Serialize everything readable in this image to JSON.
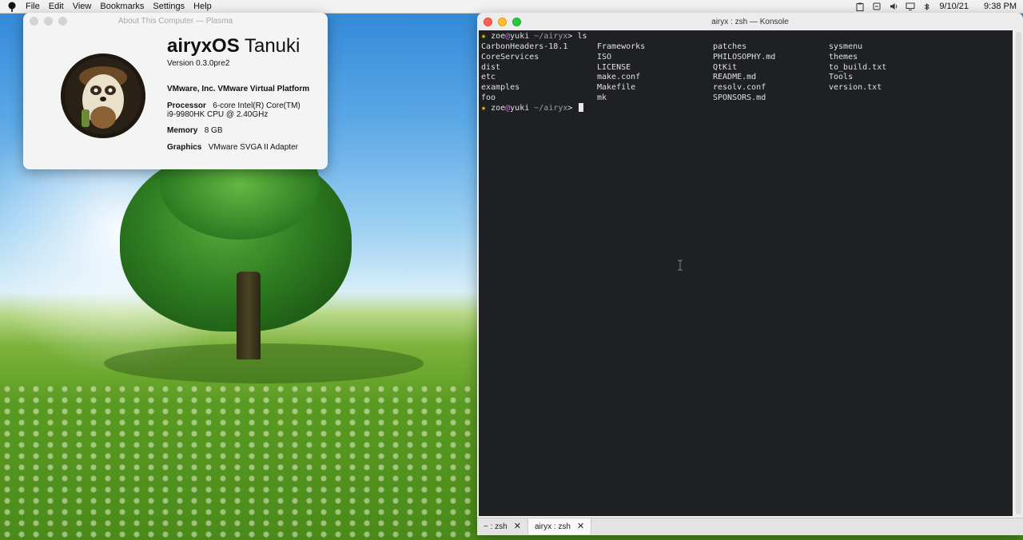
{
  "menubar": {
    "logo_icon": "tree-logo-icon",
    "items": [
      "File",
      "Edit",
      "View",
      "Bookmarks",
      "Settings",
      "Help"
    ],
    "date": "9/10/21",
    "time": "9:38 PM"
  },
  "about": {
    "title": "About This Computer — Plasma",
    "os_name_bold": "airyxOS",
    "os_name_light": " Tanuki",
    "version": "Version 0.3.0pre2",
    "platform": "VMware, Inc. VMware Virtual Platform",
    "processor_label": "Processor",
    "processor_value_1": "6-core Intel(R) Core(TM)",
    "processor_value_2": "i9-9980HK CPU @ 2.40GHz",
    "memory_label": "Memory",
    "memory_value": "8 GB",
    "graphics_label": "Graphics",
    "graphics_value": "VMware SVGA II Adapter"
  },
  "konsole": {
    "title": "airyx : zsh — Konsole",
    "prompt": {
      "star": "★",
      "user": "zoe",
      "at": "@",
      "host": "yuki",
      "path": " ~/airyx",
      "symbol": ">",
      "command": " ls"
    },
    "listing": [
      [
        "CarbonHeaders-18.1",
        "Frameworks",
        "patches",
        "sysmenu"
      ],
      [
        "CoreServices",
        "ISO",
        "PHILOSOPHY.md",
        "themes"
      ],
      [
        "dist",
        "LICENSE",
        "QtKit",
        "to_build.txt"
      ],
      [
        "etc",
        "make.conf",
        "README.md",
        "Tools"
      ],
      [
        "examples",
        "Makefile",
        "resolv.conf",
        "version.txt"
      ],
      [
        "foo",
        "mk",
        "SPONSORS.md",
        ""
      ]
    ],
    "tabs": [
      {
        "label": "~ : zsh",
        "close": "✕"
      },
      {
        "label": "airyx : zsh",
        "close": "✕"
      }
    ]
  }
}
